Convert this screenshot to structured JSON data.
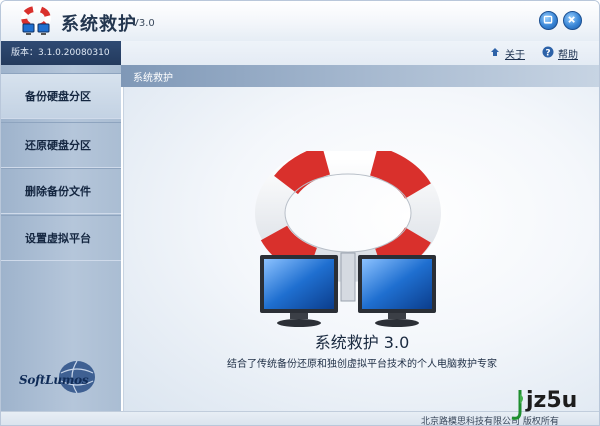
{
  "window": {
    "title": "系统救护",
    "version_badge": "V3.0"
  },
  "infobar": {
    "version_text": "版本：3.1.0.20080310",
    "about_label": "关于",
    "help_label": "帮助"
  },
  "sidebar": {
    "items": [
      {
        "label": "备份硬盘分区"
      },
      {
        "label": "还原硬盘分区"
      },
      {
        "label": "删除备份文件"
      },
      {
        "label": "设置虚拟平台"
      }
    ],
    "logo_text": "SoftLumos"
  },
  "content": {
    "section_label": "系统救护",
    "title": "系统救护 3.0",
    "subtitle": "结合了传统备份还原和独创虚拟平台技术的个人电脑救护专家"
  },
  "statusbar": {
    "text": "北京路模思科技有限公司 版权所有"
  },
  "watermark": {
    "text": "jz5u"
  },
  "colors": {
    "accent": "#2f4a73",
    "lifebuoy_red": "#d9302c",
    "screen_blue": "#1f6fd0"
  },
  "icons": {
    "app": "lifebuoy-computer-icon",
    "minimize": "minimize-icon",
    "close": "close-icon",
    "about": "about-icon",
    "help": "help-icon"
  }
}
